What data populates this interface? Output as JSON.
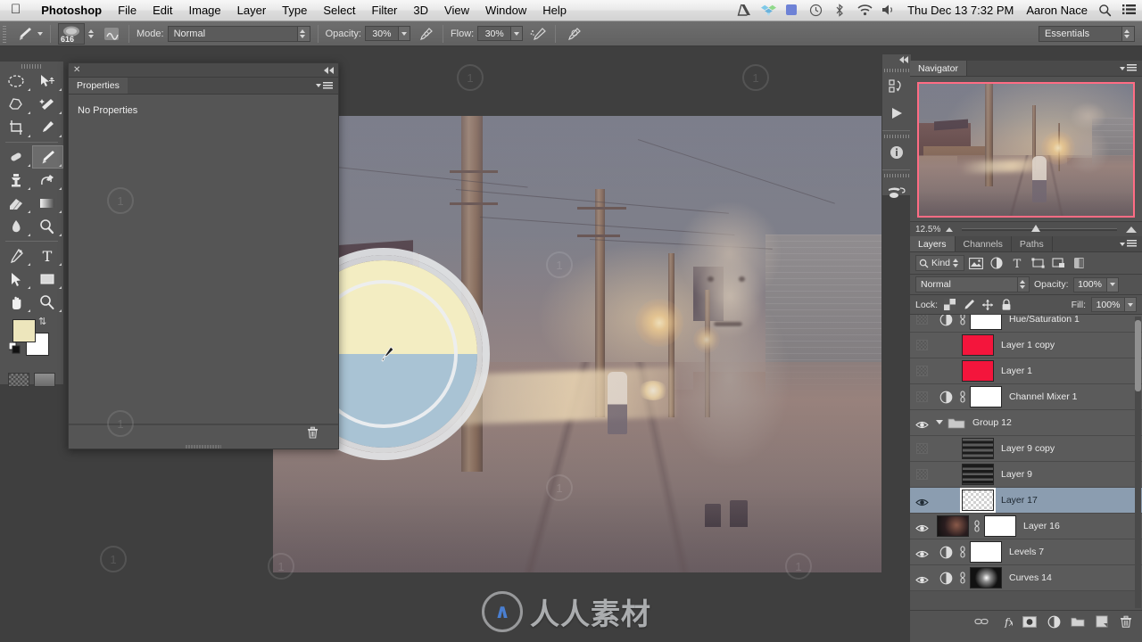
{
  "menubar": {
    "apple_icon": "apple-logo",
    "items": [
      "Photoshop",
      "File",
      "Edit",
      "Image",
      "Layer",
      "Type",
      "Select",
      "Filter",
      "3D",
      "View",
      "Window",
      "Help"
    ],
    "status_icons": [
      "google-drive-icon",
      "dropbox-icon",
      "blue-square-icon",
      "time-machine-icon",
      "bluetooth-icon",
      "wifi-icon",
      "volume-icon"
    ],
    "datetime": "Thu Dec 13  7:32 PM",
    "user": "Aaron Nace",
    "search_icon": "search-icon",
    "notification_icon": "notification-center-icon"
  },
  "options_bar": {
    "tool_icon": "brush-tool-icon",
    "brush_size": "616",
    "brush_preset_icon": "brush-preset-icon",
    "airbrush_icon": "airbrush-icon",
    "mode_label": "Mode:",
    "mode_value": "Normal",
    "opacity_label": "Opacity:",
    "opacity_value": "30%",
    "opacity_pressure_icon": "pressure-opacity-icon",
    "flow_label": "Flow:",
    "flow_value": "30%",
    "flow_airbrush_icon": "airbrush-flow-icon",
    "pressure_size_icon": "pressure-size-icon",
    "workspace": "Essentials"
  },
  "toolbar": {
    "tools": [
      {
        "name": "elliptical-marquee-tool",
        "selected": false
      },
      {
        "name": "move-tool",
        "selected": false
      },
      {
        "name": "lasso-tool",
        "selected": false
      },
      {
        "name": "magic-wand-tool",
        "selected": false
      },
      {
        "name": "crop-tool",
        "selected": false
      },
      {
        "name": "eyedropper-tool",
        "selected": false
      },
      {
        "name": "healing-brush-tool",
        "selected": false
      },
      {
        "name": "brush-tool",
        "selected": true
      },
      {
        "name": "clone-stamp-tool",
        "selected": false
      },
      {
        "name": "history-brush-tool",
        "selected": false
      },
      {
        "name": "eraser-tool",
        "selected": false
      },
      {
        "name": "gradient-tool",
        "selected": false
      },
      {
        "name": "blur-tool",
        "selected": false
      },
      {
        "name": "dodge-tool",
        "selected": false
      },
      {
        "name": "pen-tool",
        "selected": false
      },
      {
        "name": "type-tool",
        "selected": false
      },
      {
        "name": "path-selection-tool",
        "selected": false
      },
      {
        "name": "rectangle-tool",
        "selected": false
      },
      {
        "name": "hand-tool",
        "selected": false
      },
      {
        "name": "zoom-tool",
        "selected": false
      }
    ],
    "foreground_color": "#ede6bc",
    "background_color": "#ffffff",
    "quick_mask_icon": "quick-mask-icon",
    "screen_mode_icon": "screen-mode-icon"
  },
  "properties_panel": {
    "close_icon": "close-icon",
    "collapse_icon": "collapse-icon",
    "tab": "Properties",
    "menu_icon": "panel-menu-icon",
    "empty_text": "No Properties",
    "delete_icon": "trash-icon"
  },
  "icon_dock": {
    "collapse_icon": "collapse-to-icons-icon",
    "items": [
      "history-actions-icon",
      "play-icon",
      "info-icon",
      "brush-presets-icon"
    ]
  },
  "navigator": {
    "tab": "Navigator",
    "menu_icon": "panel-menu-icon",
    "zoom_level": "12.5%",
    "zoom_out_icon": "zoom-out-icon",
    "zoom_in_icon": "zoom-in-icon",
    "view_box_color": "#ff6c84"
  },
  "layers_panel": {
    "tabs": [
      {
        "label": "Layers",
        "active": true
      },
      {
        "label": "Channels",
        "active": false
      },
      {
        "label": "Paths",
        "active": false
      }
    ],
    "menu_icon": "panel-menu-icon",
    "filter_kind": "Kind",
    "filter_icons": [
      "filter-pixel-icon",
      "filter-adjustment-icon",
      "filter-type-icon",
      "filter-shape-icon",
      "filter-smart-object-icon",
      "filter-toggle-icon"
    ],
    "blend_mode": "Normal",
    "opacity_label": "Opacity:",
    "opacity_value": "100%",
    "lock_label": "Lock:",
    "lock_icons": [
      "lock-transparency-icon",
      "lock-image-icon",
      "lock-position-icon",
      "lock-all-icon"
    ],
    "fill_label": "Fill:",
    "fill_value": "100%",
    "layers": [
      {
        "name": "",
        "visible": false,
        "type": "clipped-partial",
        "thumb": "white",
        "selected": false,
        "partial": true
      },
      {
        "name": "Hue/Saturation 1",
        "visible": false,
        "type": "adjustment",
        "thumb": "white",
        "mask": true,
        "selected": false
      },
      {
        "name": "Layer 1 copy",
        "visible": false,
        "type": "pixel",
        "thumb": "#f4153c",
        "selected": false
      },
      {
        "name": "Layer 1",
        "visible": false,
        "type": "pixel",
        "thumb": "#f4153c",
        "selected": false
      },
      {
        "name": "Channel Mixer 1",
        "visible": false,
        "type": "adjustment",
        "thumb": "white",
        "mask": true,
        "selected": false
      },
      {
        "name": "Group 12",
        "visible": true,
        "type": "group",
        "expanded": true,
        "selected": false
      },
      {
        "name": "Layer 9 copy",
        "visible": false,
        "type": "pixel",
        "thumb": "half-black",
        "selected": false
      },
      {
        "name": "Layer 9",
        "visible": false,
        "type": "pixel",
        "thumb": "half-black",
        "selected": false
      },
      {
        "name": "Layer 17",
        "visible": true,
        "type": "pixel",
        "thumb": "checker",
        "selected": true
      },
      {
        "name": "Layer 16",
        "visible": true,
        "type": "pixel",
        "thumb": "dark-photo",
        "mask": true,
        "selected": false
      },
      {
        "name": "Levels 7",
        "visible": true,
        "type": "adjustment",
        "thumb": "white",
        "mask": true,
        "selected": false
      },
      {
        "name": "Curves 14",
        "visible": true,
        "type": "adjustment",
        "thumb": "black-glow",
        "mask": true,
        "selected": false
      }
    ],
    "bottom_icons": [
      "link-layers-icon",
      "add-style-icon",
      "add-mask-icon",
      "add-adjustment-icon",
      "new-group-icon",
      "new-layer-icon",
      "delete-layer-icon"
    ]
  },
  "canvas": {
    "document_name": "",
    "hud_color_picker": {
      "name": "hud-color-ring",
      "top_color": "#f3edc2",
      "bottom_color": "#a9c3d4",
      "ring_color": "#e4e7e9"
    },
    "cursor_icon": "eyedropper-cursor"
  },
  "watermark": {
    "text": "人人素材",
    "logo": "rr-logo-icon",
    "tiles": [
      "1",
      "1",
      "1",
      "1",
      "1",
      "1",
      "1",
      "1"
    ]
  }
}
